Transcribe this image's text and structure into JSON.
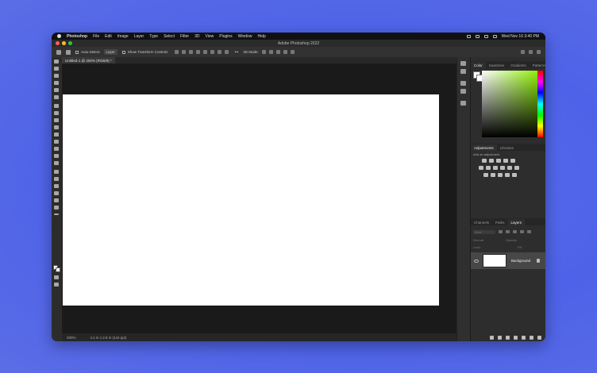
{
  "menubar": {
    "items": [
      "Photoshop",
      "File",
      "Edit",
      "Image",
      "Layer",
      "Type",
      "Select",
      "Filter",
      "3D",
      "View",
      "Plugins",
      "Window",
      "Help"
    ],
    "datetime": "Wed Nov 16 3:40 PM"
  },
  "window": {
    "title": "Adobe Photoshop 2022"
  },
  "options": {
    "auto_select_label": "Auto-Select:",
    "auto_select_value": "Layer",
    "transform_label": "Show Transform Controls",
    "mode_3d": "3D Mode:"
  },
  "document": {
    "tab_title": "Untitled-1 @ 200% (RGB/8) *"
  },
  "status": {
    "zoom": "200%",
    "info": "4.1 in x 2.6 in (144 ppi)"
  },
  "color_panel": {
    "tabs": [
      "Color",
      "Swatches",
      "Gradients",
      "Patterns"
    ],
    "hue_color": "#8cf000"
  },
  "adjustments_panel": {
    "tabs": [
      "Adjustments",
      "Libraries"
    ],
    "add_label": "Add an adjustment"
  },
  "layers_panel": {
    "tabs": [
      "Channels",
      "Paths",
      "Layers"
    ],
    "search_placeholder": "Kind",
    "blend_mode": "Normal",
    "opacity_label": "Opacity:",
    "lock_label": "Lock:",
    "fill_label": "Fill:",
    "layers": [
      {
        "name": "Background"
      }
    ]
  },
  "colors": {
    "accent": "#5a6ff0",
    "canvas": "#ffffff",
    "window_bg": "#1f1f1f"
  }
}
